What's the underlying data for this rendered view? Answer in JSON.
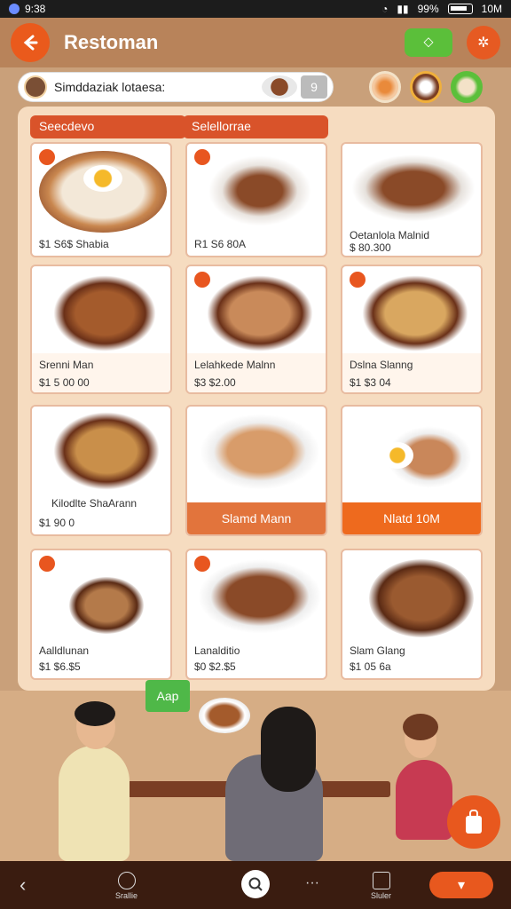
{
  "status_bar": {
    "time": "9:38",
    "battery": "99%",
    "network": "10M"
  },
  "header": {
    "title": "Restoman"
  },
  "search": {
    "text": "Simddaziak lotaesa:",
    "badge": "9"
  },
  "categories": [
    "Seecdevo",
    "Selellorrae"
  ],
  "menu_items": [
    {
      "name": "",
      "price": "$1 S6$ Shabia",
      "variant": "plain"
    },
    {
      "name": "",
      "price": "R1 S6 80A",
      "variant": "plain"
    },
    {
      "name": "Oetanlola Malnid",
      "price": "$ 80.300",
      "variant": "plain"
    },
    {
      "name": "Srenni Man",
      "price": "$1 5 00 00",
      "variant": "plain"
    },
    {
      "name": "Lelahkede Malnn",
      "price": "$3 $2.00",
      "variant": "plain"
    },
    {
      "name": "Dslna Slanng",
      "price": "$1 $3 04",
      "variant": "plain"
    },
    {
      "name": "Kilodlte ShaArann",
      "price": "$1 90 0",
      "variant": "plain"
    },
    {
      "name": "Slamd Mann",
      "price": "",
      "variant": "brown"
    },
    {
      "name": "Nlatd 10M",
      "price": "",
      "variant": "orange"
    },
    {
      "name": "Aalldlunan",
      "price": "$1 $6.$5",
      "variant": "plain"
    },
    {
      "name": "Lanalditio",
      "price": "$0 $2.$5",
      "variant": "plain"
    },
    {
      "name": "Slam Glang",
      "price": "$1 05 6a",
      "variant": "plain"
    }
  ],
  "app_chip": "Aap",
  "bottom_nav": {
    "left_label": "Srallie",
    "right_label": "Sluler"
  },
  "colors": {
    "accent": "#e8581e",
    "panel": "#f6dcc0",
    "header": "#b8835a"
  }
}
